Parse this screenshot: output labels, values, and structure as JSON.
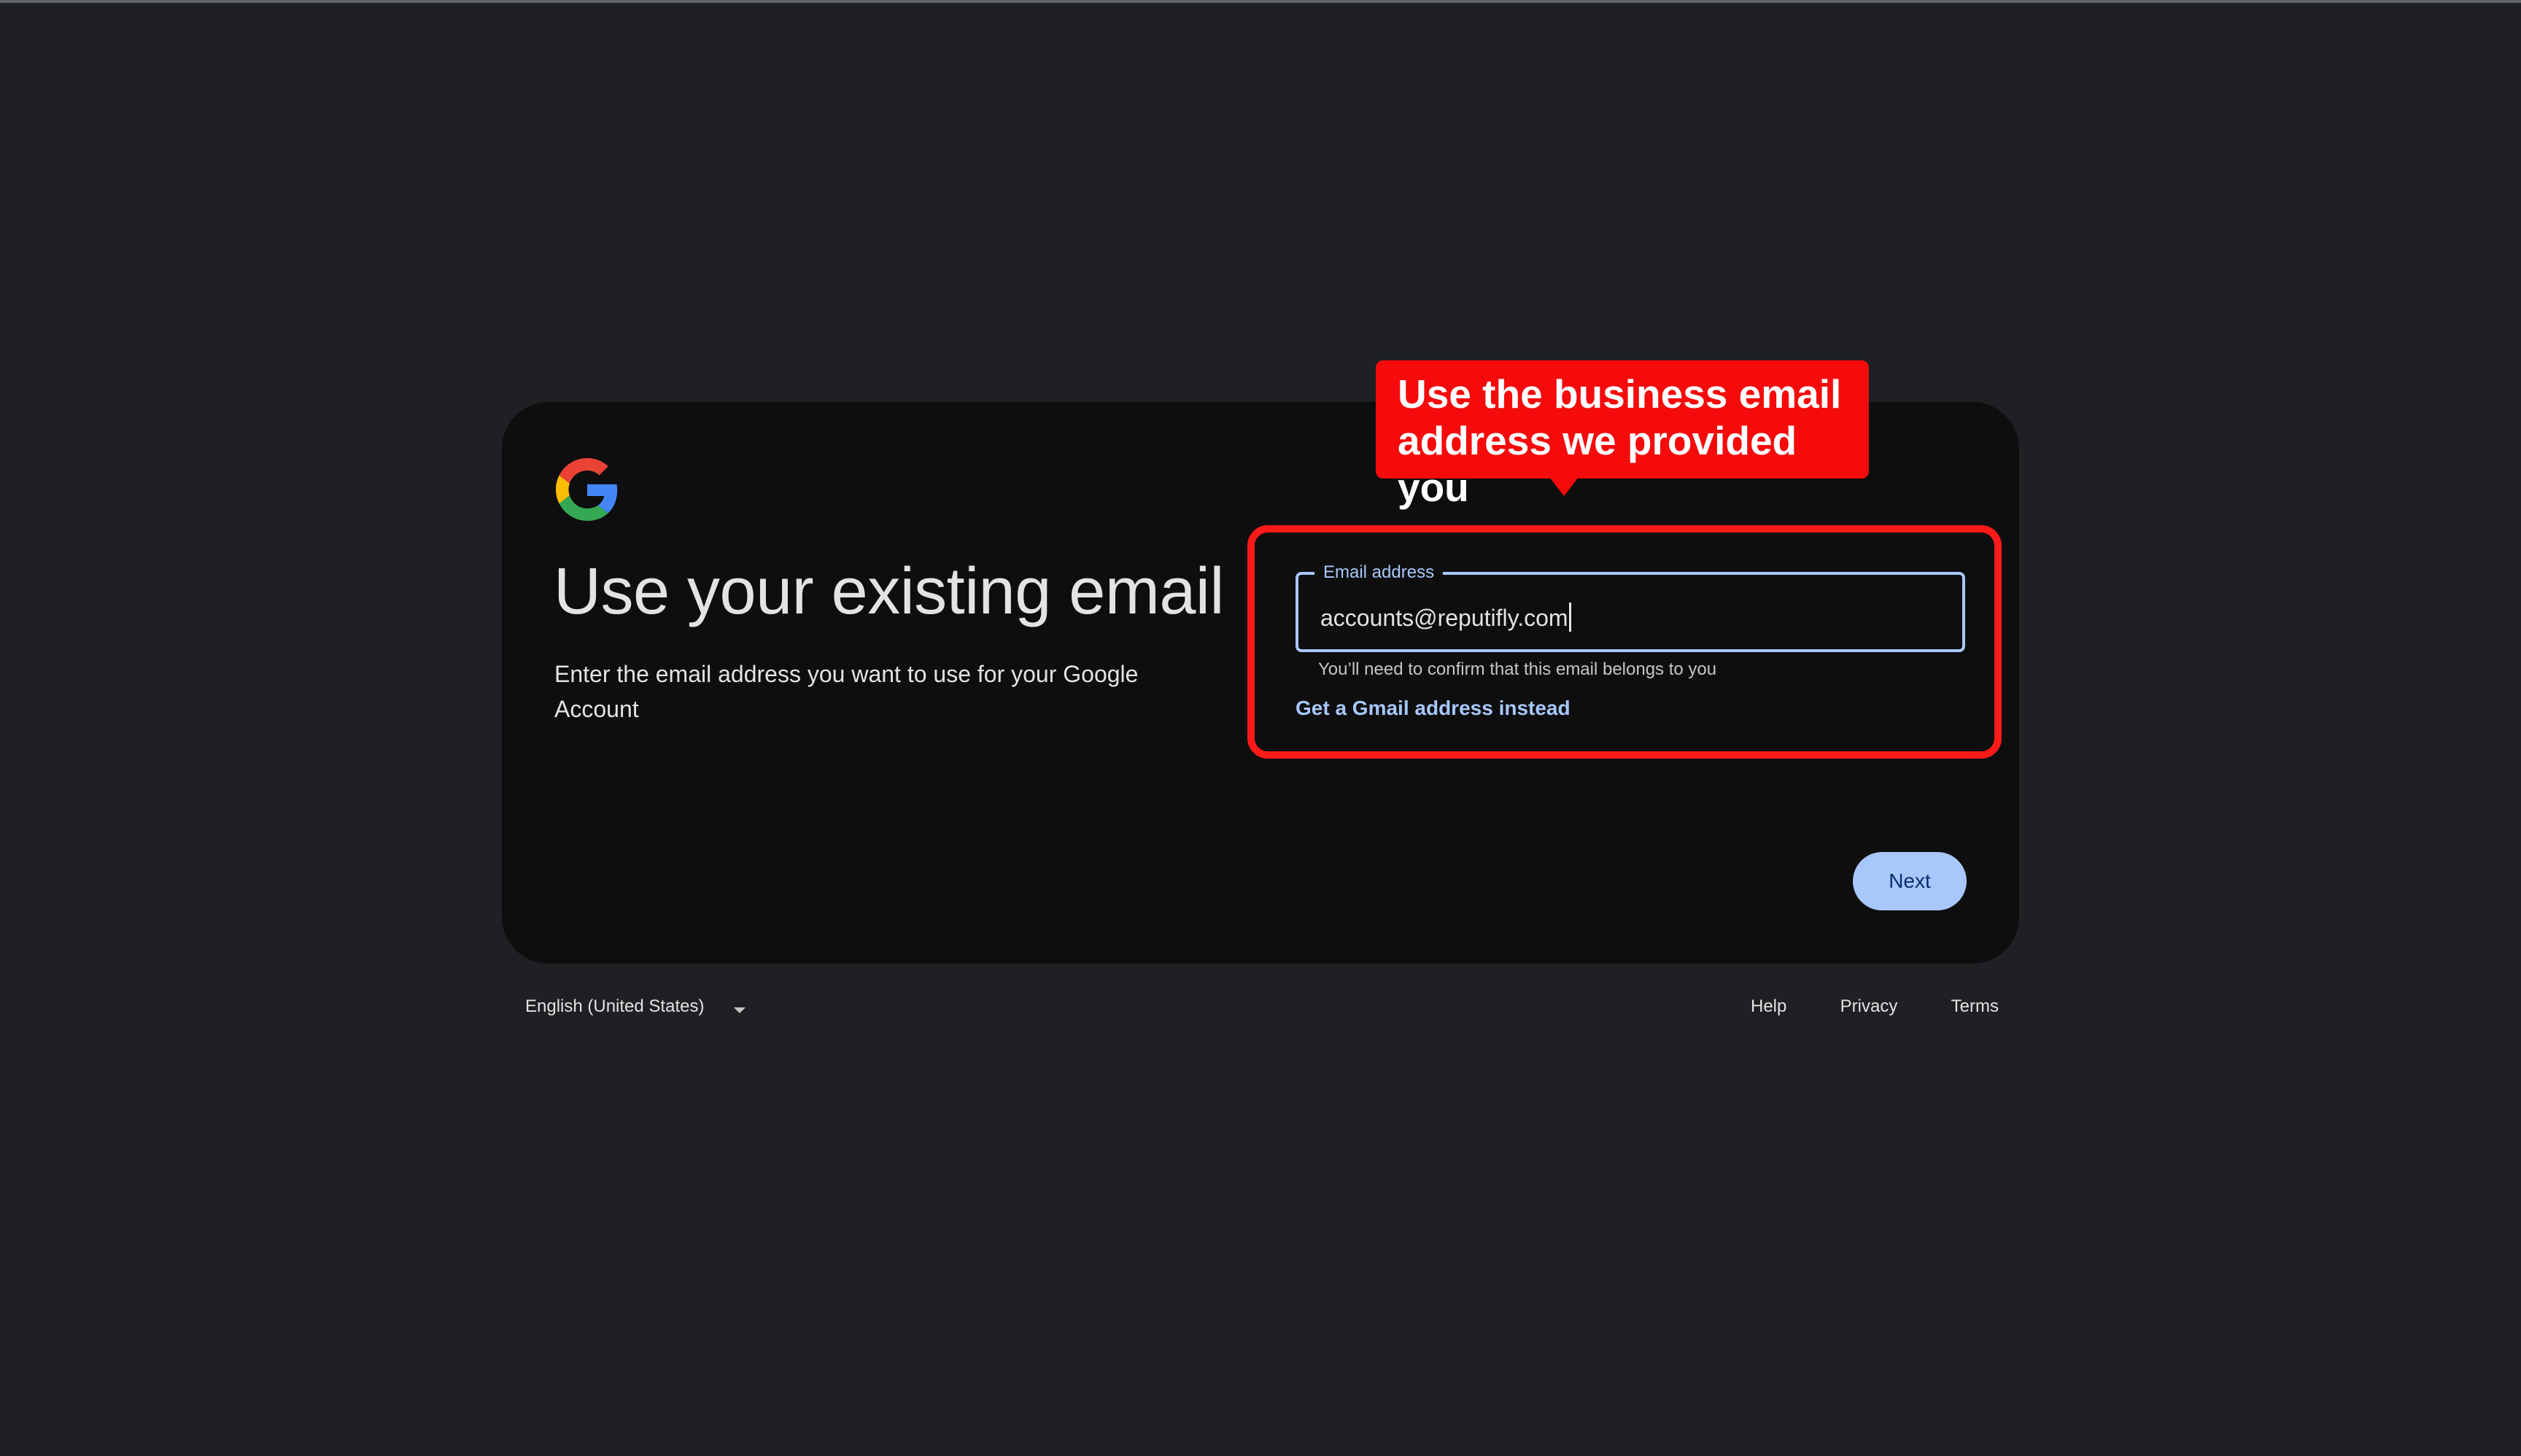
{
  "page": {
    "heading": "Use your existing email",
    "subtitle": "Enter the email address you want to use for your Google Account"
  },
  "form": {
    "email_label": "Email address",
    "email_value": "accounts@reputifly.com",
    "helper_text": "You’ll need to confirm that this email belongs to you",
    "gmail_link": "Get a Gmail address instead",
    "next_label": "Next"
  },
  "annotation": {
    "callout_text": "Use the business email address we provided you",
    "color": "#ff1a1a"
  },
  "footer": {
    "language": "English (United States)",
    "links": [
      "Help",
      "Privacy",
      "Terms"
    ]
  },
  "colors": {
    "background": "#1f2023",
    "card": "#0e0e0f",
    "accent": "#a8c7fa",
    "button_text": "#062e6f"
  },
  "icons": {
    "logo": "google-g-logo-icon",
    "dropdown": "chevron-down-icon"
  }
}
